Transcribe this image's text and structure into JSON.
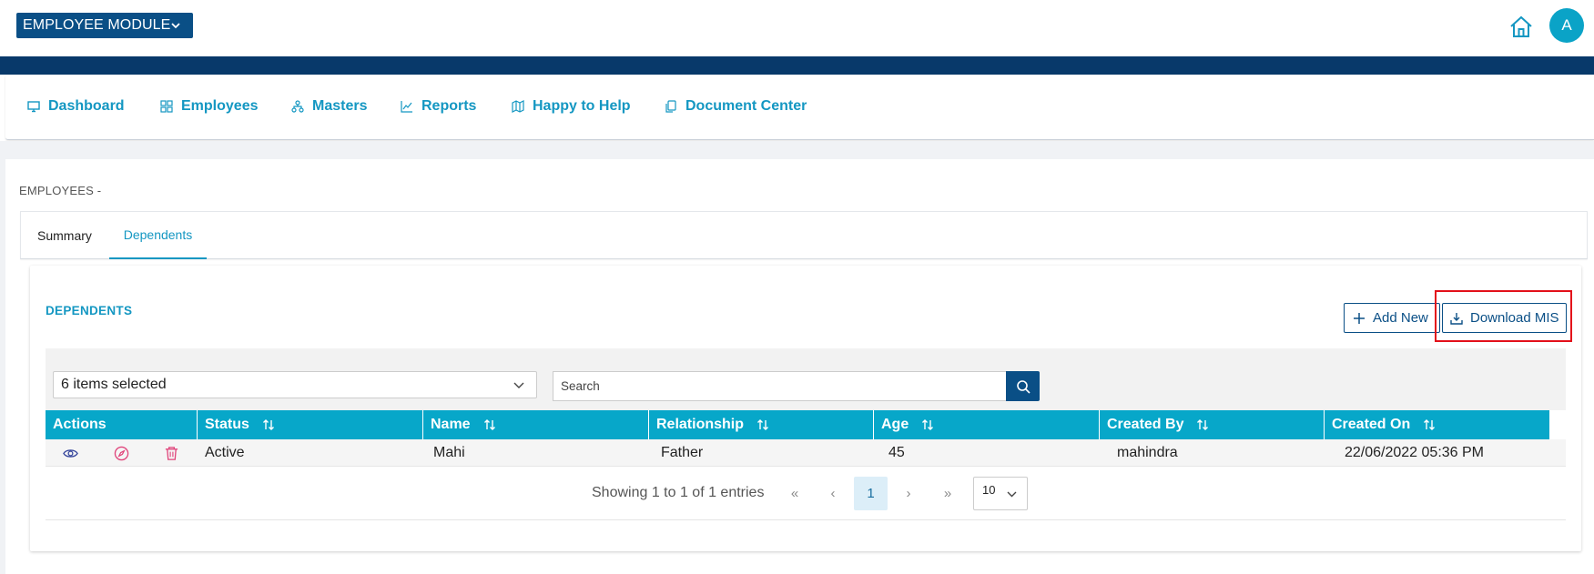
{
  "header": {
    "module_label": "EMPLOYEE MODULE",
    "avatar_letter": "A"
  },
  "nav": {
    "items": [
      {
        "label": "Dashboard",
        "icon": "monitor-icon"
      },
      {
        "label": "Employees",
        "icon": "grid-icon"
      },
      {
        "label": "Masters",
        "icon": "sitemap-icon"
      },
      {
        "label": "Reports",
        "icon": "chart-line-icon"
      },
      {
        "label": "Happy to Help",
        "icon": "map-icon"
      },
      {
        "label": "Document Center",
        "icon": "documents-icon"
      }
    ]
  },
  "breadcrumb": "EMPLOYEES -",
  "tabs": [
    {
      "label": "Summary",
      "active": false
    },
    {
      "label": "Dependents",
      "active": true
    }
  ],
  "card": {
    "title": "DEPENDENTS",
    "add_new_label": "Add New",
    "download_label": "Download MIS"
  },
  "filter": {
    "columns_selected": "6 items selected",
    "search_placeholder": "Search"
  },
  "table": {
    "columns": [
      "Actions",
      "Status",
      "Name",
      "Relationship",
      "Age",
      "Created By",
      "Created On"
    ],
    "rows": [
      {
        "status": "Active",
        "name": "Mahi",
        "relationship": "Father",
        "age": "45",
        "created_by": "mahindra",
        "created_on": "22/06/2022 05:36 PM"
      }
    ]
  },
  "pagination": {
    "info": "Showing 1 to 1 of 1 entries",
    "first": "«",
    "prev": "‹",
    "current_page": "1",
    "next": "›",
    "last": "»",
    "page_size": "10"
  },
  "colors": {
    "primary": "#0a4f86",
    "accent": "#1497c2",
    "table_header": "#07a7c9",
    "highlight": "#e3101a",
    "action_view": "#3a4a9e",
    "action_edit_delete": "#e0457b"
  }
}
